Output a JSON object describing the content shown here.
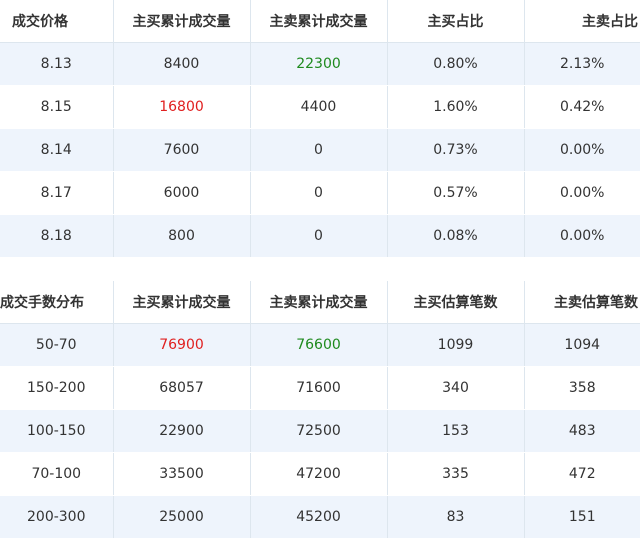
{
  "price_table": {
    "headers": [
      "成交价格",
      "主买累计成交量",
      "主卖累计成交量",
      "主买占比",
      "主卖占比"
    ],
    "rows": [
      [
        "8.13",
        "8400",
        "22300",
        "0.80%",
        "2.13%"
      ],
      [
        "8.15",
        "16800",
        "4400",
        "1.60%",
        "0.42%"
      ],
      [
        "8.14",
        "7600",
        "0",
        "0.73%",
        "0.00%"
      ],
      [
        "8.17",
        "6000",
        "0",
        "0.57%",
        "0.00%"
      ],
      [
        "8.18",
        "800",
        "0",
        "0.08%",
        "0.00%"
      ]
    ],
    "highlights": {
      "red": "#e02020",
      "green": "#1e8a1e"
    }
  },
  "lot_table": {
    "headers": [
      "成交手数分布",
      "主买累计成交量",
      "主卖累计成交量",
      "主买估算笔数",
      "主卖估算笔数"
    ],
    "rows": [
      [
        "50-70",
        "76900",
        "76600",
        "1099",
        "1094"
      ],
      [
        "150-200",
        "68057",
        "71600",
        "340",
        "358"
      ],
      [
        "100-150",
        "22900",
        "72500",
        "153",
        "483"
      ],
      [
        "70-100",
        "33500",
        "47200",
        "335",
        "472"
      ],
      [
        "200-300",
        "25000",
        "45200",
        "83",
        "151"
      ]
    ]
  },
  "colors": {
    "row_stripe": "#eef4fc",
    "border": "#dde6ee"
  }
}
